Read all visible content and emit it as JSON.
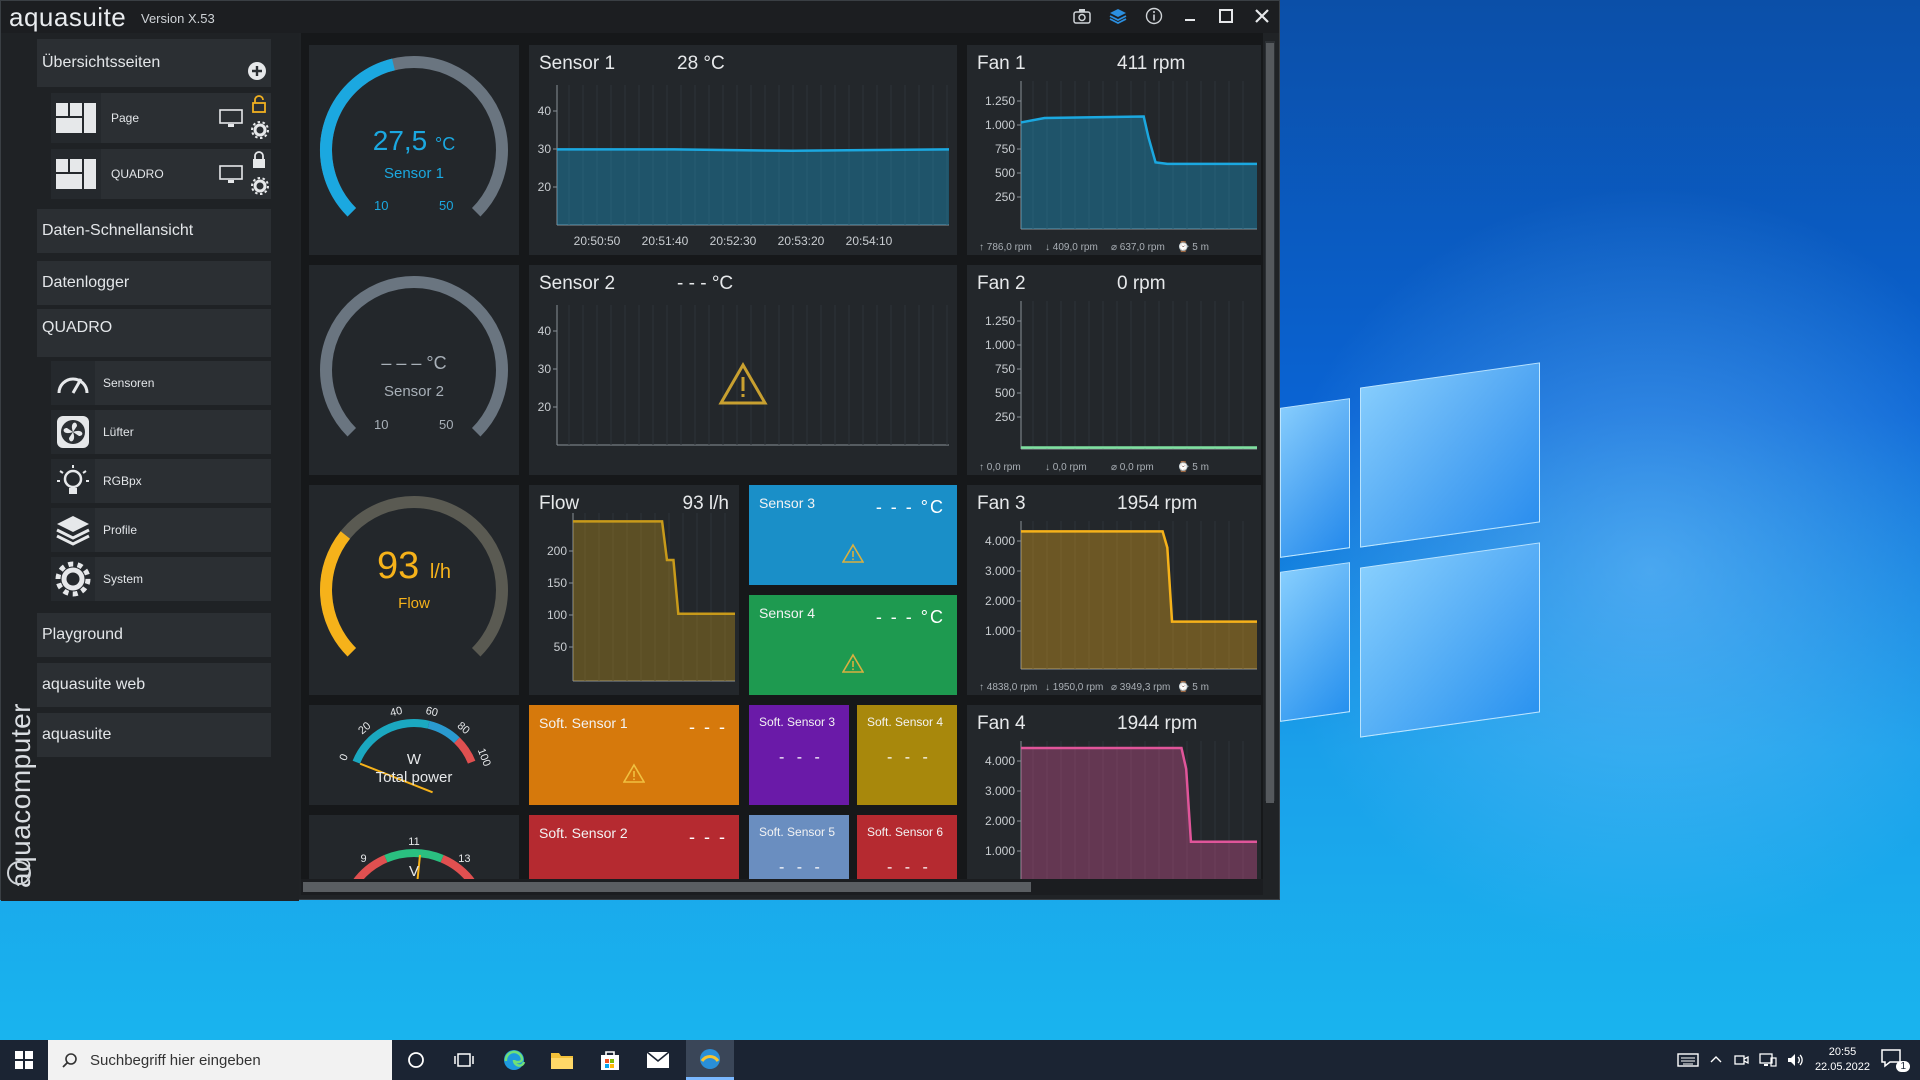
{
  "app": {
    "name": "aquasuite",
    "version": "Version X.53",
    "brand_vertical": "aquacomputer"
  },
  "sidebar": {
    "overview_header": "Übersichtsseiten",
    "pages": [
      {
        "label": "Page"
      },
      {
        "label": "QUADRO"
      }
    ],
    "daten_schnellansicht": "Daten-Schnellansicht",
    "datenlogger": "Datenlogger",
    "device": "QUADRO",
    "device_items": [
      {
        "label": "Sensoren",
        "icon": "gauge-icon"
      },
      {
        "label": "Lüfter",
        "icon": "fan-icon"
      },
      {
        "label": "RGBpx",
        "icon": "lightbulb-icon"
      },
      {
        "label": "Profile",
        "icon": "layers-icon"
      },
      {
        "label": "System",
        "icon": "gear-icon"
      }
    ],
    "playground": "Playground",
    "web": "aquasuite web",
    "aquasuite": "aquasuite"
  },
  "gauges": {
    "sensor1": {
      "value": "27,5",
      "unit": "°C",
      "name": "Sensor 1",
      "min": "10",
      "max": "50",
      "fraction": 0.45,
      "color": "#1ba8e0"
    },
    "sensor2": {
      "value": "– – –",
      "unit": "°C",
      "name": "Sensor 2",
      "min": "10",
      "max": "50",
      "fraction": 0.0,
      "color": "#a8b0b8"
    },
    "flow": {
      "value": "93",
      "unit": "l/h",
      "name": "Flow",
      "fraction": 0.31,
      "color": "#f6b21a"
    }
  },
  "power": {
    "unit": "W",
    "label": "Total power",
    "ticks": [
      "0",
      "20",
      "40",
      "60",
      "80",
      "100"
    ],
    "value": 0.0
  },
  "voltage": {
    "unit": "V",
    "ticks": [
      "9",
      "11",
      "13"
    ]
  },
  "charts": {
    "sensor1": {
      "title": "Sensor 1",
      "value": "28 °C",
      "yticks": [
        "40",
        "30",
        "20"
      ],
      "xticks": [
        "20:50:50",
        "20:51:40",
        "20:52:30",
        "20:53:20",
        "20:54:10"
      ],
      "color": "#1ba8e0"
    },
    "sensor2": {
      "title": "Sensor 2",
      "value": "- - - °C",
      "yticks": [
        "40",
        "30",
        "20"
      ]
    },
    "flow": {
      "title": "Flow",
      "value": "93 l/h",
      "yticks": [
        "200",
        "150",
        "100",
        "50"
      ],
      "color": "#c89a1a"
    },
    "fan1": {
      "title": "Fan 1",
      "value": "411 rpm",
      "yticks": [
        "1.250",
        "1.000",
        "750",
        "500",
        "250"
      ],
      "stats": [
        "↑ 786,0 rpm",
        "↓ 409,0 rpm",
        "⌀ 637,0 rpm",
        "⌚ 5 m"
      ],
      "color": "#1ba8e0"
    },
    "fan2": {
      "title": "Fan 2",
      "value": "0 rpm",
      "yticks": [
        "1.250",
        "1.000",
        "750",
        "500",
        "250"
      ],
      "stats": [
        "↑ 0,0 rpm",
        "↓ 0,0 rpm",
        "⌀ 0,0 rpm",
        "⌚ 5 m"
      ],
      "color": "#7ee0a0"
    },
    "fan3": {
      "title": "Fan 3",
      "value": "1954 rpm",
      "yticks": [
        "4.000",
        "3.000",
        "2.000",
        "1.000"
      ],
      "stats": [
        "↑ 4838,0 rpm",
        "↓ 1950,0 rpm",
        "⌀ 3949,3 rpm",
        "⌚ 5 m"
      ],
      "color": "#f6b21a"
    },
    "fan4": {
      "title": "Fan 4",
      "value": "1944 rpm",
      "yticks": [
        "4.000",
        "3.000",
        "2.000",
        "1.000"
      ],
      "color": "#e0559a"
    }
  },
  "color_tiles": {
    "sensor3": {
      "title": "Sensor 3",
      "value": "- - - °C",
      "color": "#1a8fc8"
    },
    "sensor4": {
      "title": "Sensor 4",
      "value": "- - - °C",
      "color": "#1e9a50"
    },
    "soft1": {
      "title": "Soft. Sensor 1",
      "value": "- - -",
      "color": "#d6790c"
    },
    "soft2": {
      "title": "Soft. Sensor 2",
      "value": "- - -",
      "color": "#b52a30"
    },
    "soft3": {
      "title": "Soft. Sensor 3",
      "value": "- - -",
      "color": "#6a1aa8"
    },
    "soft4": {
      "title": "Soft. Sensor 4",
      "value": "- - -",
      "color": "#a8880c"
    },
    "soft5": {
      "title": "Soft. Sensor 5",
      "value": "- - -",
      "color": "#6a8ec0"
    },
    "soft6": {
      "title": "Soft. Sensor 6",
      "value": "- - -",
      "color": "#b52a30"
    }
  },
  "taskbar": {
    "search_placeholder": "Suchbegriff hier eingeben",
    "time": "20:55",
    "date": "22.05.2022",
    "notifications": "1"
  }
}
